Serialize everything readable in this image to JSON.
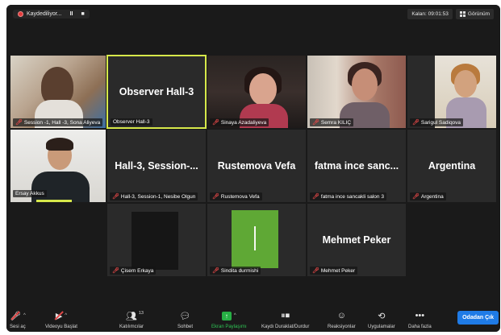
{
  "topbar": {
    "recording_label": "Kaydediliyor...",
    "pause_label": "II",
    "stop_label": "■",
    "timer": "Kalan: 09:01:53",
    "view_label": "Görünüm"
  },
  "tiles": [
    {
      "name": "Session -1, Hall -3, Sona Aliyeva",
      "muted": true,
      "video": "v1"
    },
    {
      "name": "Observer Hall-3",
      "center": "Observer Hall-3",
      "muted": false,
      "active": true
    },
    {
      "name": "Sinaya Azadaliyeva",
      "muted": true,
      "video": "v3"
    },
    {
      "name": "Semra KILIÇ",
      "muted": true,
      "video": "v4"
    },
    {
      "name": "Sarigul Sadiqova",
      "muted": true,
      "video": "v5"
    },
    {
      "name": "Ersay Akkus",
      "muted": false,
      "video": "v6"
    },
    {
      "name": "Hall-3, Session-1, Nesibe Olgun",
      "center": "Hall-3, Session-...",
      "muted": true
    },
    {
      "name": "Rustemova Vefa",
      "center": "Rustemova Vefa",
      "muted": true
    },
    {
      "name": "fatma ince sancakli salon 3",
      "center": "fatma ince sanc...",
      "muted": true
    },
    {
      "name": "Argentina",
      "center": "Argentina",
      "muted": true
    },
    {
      "name": "Çisem Erkaya",
      "muted": true,
      "video": "v7"
    },
    {
      "name": "Sindita durmishi",
      "muted": true,
      "video": "v8"
    },
    {
      "name": "Mehmet Peker",
      "center": "Mehmet Peker",
      "muted": true
    }
  ],
  "toolbar": {
    "mute_label": "Sesi aç",
    "video_label": "Videoyu Başlat",
    "participants_label": "Katılımcılar",
    "participants_count": "13",
    "chat_label": "Sohbet",
    "share_label": "Ekran Paylaşımı",
    "record_label": "Kaydı Duraklat/Durdur",
    "reactions_label": "Reaksiyonlar",
    "apps_label": "Uygulamalar",
    "more_label": "Daha fazla",
    "end_label": "Odadan Çık"
  }
}
